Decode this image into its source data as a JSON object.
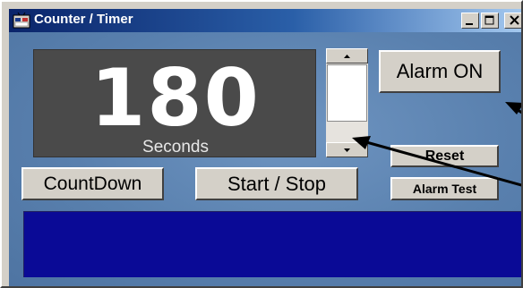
{
  "window": {
    "title": "Counter / Timer",
    "app_icon": "timer-app-icon",
    "controls": {
      "minimize": "_",
      "maximize": "□",
      "close": "X"
    }
  },
  "display": {
    "value": "180",
    "unit": "Seconds"
  },
  "scrollbar": {
    "up_icon": "arrow-up-icon",
    "down_icon": "arrow-down-icon"
  },
  "buttons": {
    "alarm_on": "Alarm ON",
    "reset": "Reset",
    "alarm_test": "Alarm Test",
    "countdown": "CountDown",
    "start_stop": "Start / Stop"
  },
  "status_panel": {
    "text": ""
  },
  "colors": {
    "title_start": "#0a246a",
    "title_end": "#a6caf0",
    "client_bg": "#5e86b4",
    "display_bg": "#4a4a4a",
    "status_panel_bg": "#0a0a96",
    "button_face": "#d4d0c8",
    "annotation_arrow": "#000000"
  }
}
